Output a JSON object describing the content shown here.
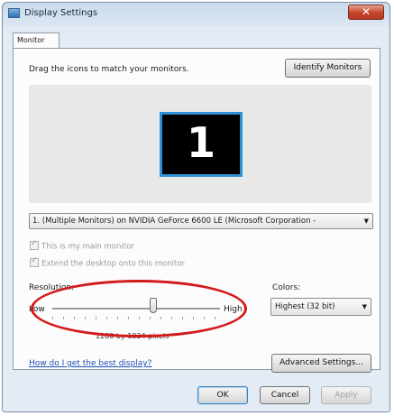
{
  "window": {
    "title": "Display Settings",
    "close_glyph": "✕"
  },
  "tabs": [
    {
      "label": "Monitor"
    }
  ],
  "monitor": {
    "instruction": "Drag the icons to match your monitors.",
    "identify_button": "Identify Monitors",
    "monitor_number": "1",
    "selector_value": "1. (Multiple Monitors) on NVIDIA GeForce 6600 LE (Microsoft Corporation -",
    "main_monitor_label": "This is my main monitor",
    "extend_desktop_label": "Extend the desktop onto this monitor"
  },
  "resolution": {
    "label": "Resolution:",
    "low": "Low",
    "high": "High",
    "value": "1280 by 1024 pixels",
    "slider_fraction": 0.6
  },
  "colors": {
    "label": "Colors:",
    "selected": "Highest (32 bit)"
  },
  "help_link": "How do I get the best display?",
  "advanced_button": "Advanced Settings...",
  "footer": {
    "ok": "OK",
    "cancel": "Cancel",
    "apply": "Apply"
  },
  "theme": {
    "selection_highlight": "#d31a1a",
    "monitor_border": "#2f8fd6"
  }
}
